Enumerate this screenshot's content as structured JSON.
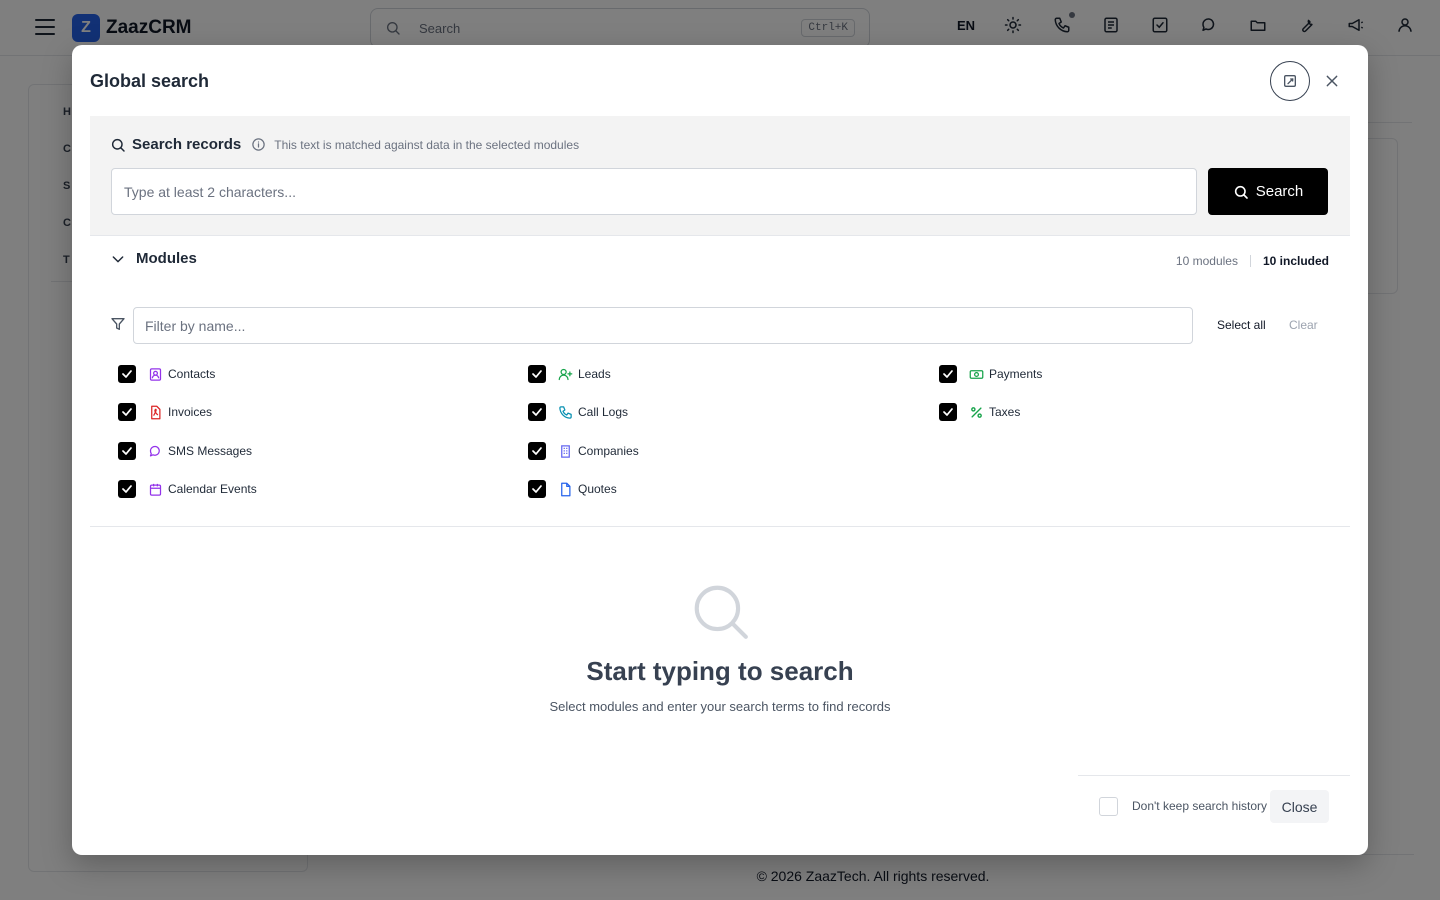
{
  "app": {
    "logo_letter": "Z",
    "name": "ZaazCRM",
    "search_placeholder": "Search",
    "search_shortcut": "Ctrl+K",
    "language": "EN",
    "sidebar_initials": [
      "H",
      "C",
      "S",
      "C",
      "T"
    ],
    "footer": "© 2026 ZaazTech. All rights reserved."
  },
  "modal": {
    "title": "Global search",
    "search": {
      "title": "Search records",
      "hint": "This text is matched against data in the selected modules",
      "placeholder": "Type at least 2 characters...",
      "value": "",
      "button_label": "Search"
    },
    "modules": {
      "title": "Modules",
      "count_label": "10 modules",
      "included_label": "10 included",
      "filter_placeholder": "Filter by name...",
      "select_all_label": "Select all",
      "clear_label": "Clear",
      "items": [
        {
          "label": "Contacts",
          "checked": true,
          "icon": "contact-card-icon",
          "color": "#9333ea"
        },
        {
          "label": "Invoices",
          "checked": true,
          "icon": "file-pdf-icon",
          "color": "#dc2626"
        },
        {
          "label": "SMS Messages",
          "checked": true,
          "icon": "chat-bubbles-icon",
          "color": "#9333ea"
        },
        {
          "label": "Calendar Events",
          "checked": true,
          "icon": "calendar-icon",
          "color": "#9333ea"
        },
        {
          "label": "Leads",
          "checked": true,
          "icon": "user-plus-icon",
          "color": "#16a34a"
        },
        {
          "label": "Call Logs",
          "checked": true,
          "icon": "phone-icon",
          "color": "#0891b2"
        },
        {
          "label": "Companies",
          "checked": true,
          "icon": "building-icon",
          "color": "#6366f1"
        },
        {
          "label": "Quotes",
          "checked": true,
          "icon": "document-icon",
          "color": "#2563eb"
        },
        {
          "label": "Payments",
          "checked": true,
          "icon": "banknote-icon",
          "color": "#16a34a"
        },
        {
          "label": "Taxes",
          "checked": true,
          "icon": "percent-icon",
          "color": "#16a34a"
        }
      ]
    },
    "empty": {
      "title": "Start typing to search",
      "subtitle": "Select modules and enter your search terms to find records"
    },
    "footer": {
      "history_label": "Don't keep search history",
      "history_checked": false,
      "close_label": "Close"
    }
  }
}
